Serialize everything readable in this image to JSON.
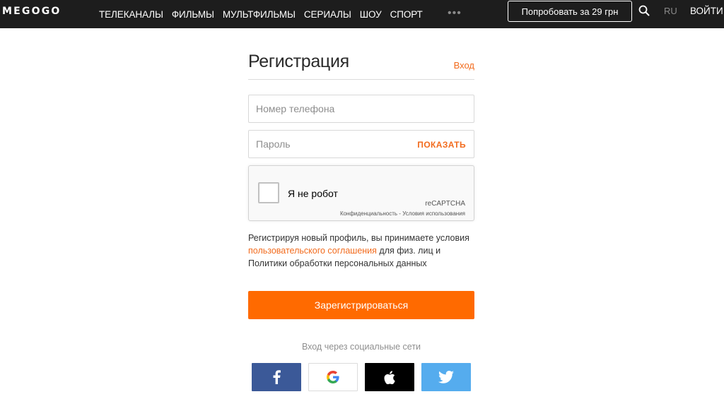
{
  "header": {
    "logo": "MEGOGO",
    "nav": [
      "ТЕЛЕКАНАЛЫ",
      "ФИЛЬМЫ",
      "МУЛЬТФИЛЬМЫ",
      "СЕРИАЛЫ",
      "ШОУ",
      "СПОРТ"
    ],
    "more": "•••",
    "try_button": "Попробовать за 29 грн",
    "search_icon": "search-icon",
    "language": "RU",
    "login": "ВОЙТИ"
  },
  "form": {
    "title": "Регистрация",
    "signin_link": "Вход",
    "phone_placeholder": "Номер телефона",
    "password_placeholder": "Пароль",
    "show_label": "ПОКАЗАТЬ",
    "captcha": {
      "label": "Я не робот",
      "brand": "reCAPTCHA",
      "terms": "Конфиденциальность - Условия использования"
    },
    "agreement": {
      "part1": "Регистрируя новый профиль, вы принимаете условия",
      "link": "пользовательского соглашения",
      "part2": " для физ. лиц и",
      "part3": "Политики обработки персональных данных"
    },
    "register_button": "Зарегистрироваться",
    "social_label": "Вход через социальные сети",
    "socials": [
      "facebook-icon",
      "google-icon",
      "apple-icon",
      "twitter-icon"
    ]
  },
  "colors": {
    "accent": "#ff6a00",
    "link": "#f26b1d",
    "header_bg": "#1d1d1d",
    "facebook": "#3b5998",
    "twitter": "#55acee"
  }
}
